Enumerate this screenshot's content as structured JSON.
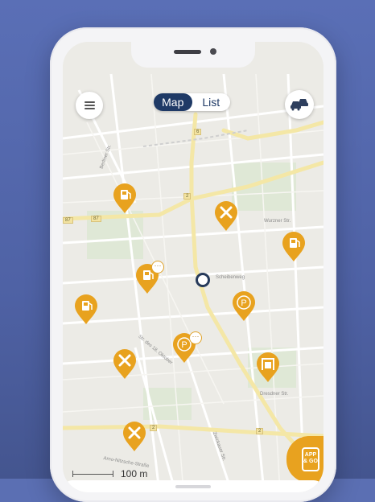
{
  "app": {
    "toggle": {
      "map_label": "Map",
      "list_label": "List",
      "active": "Map"
    }
  },
  "map": {
    "scale_label": "100 m",
    "street_labels": [
      "Scheibenweg",
      "Berliner Str.",
      "Wurzner Str.",
      "Str. des 18. Oktober",
      "Arno-Nitzsche-Straße",
      "Zwickauer Str.",
      "Dresdner Str."
    ],
    "route_shields": [
      "87",
      "87",
      "2",
      "2",
      "2",
      "6"
    ],
    "pins": [
      {
        "type": "fuel",
        "icon": "fuel-pump-icon"
      },
      {
        "type": "repair",
        "icon": "wrench-screwdriver-icon"
      },
      {
        "type": "fuel",
        "icon": "fuel-pump-icon"
      },
      {
        "type": "fuel",
        "icon": "fuel-pump-icon",
        "more": true
      },
      {
        "type": "parking",
        "icon": "parking-icon"
      },
      {
        "type": "fuel",
        "icon": "fuel-pump-icon"
      },
      {
        "type": "repair",
        "icon": "wrench-screwdriver-icon"
      },
      {
        "type": "parking",
        "icon": "parking-icon",
        "more": true
      },
      {
        "type": "car-wash",
        "icon": "car-wash-icon"
      },
      {
        "type": "repair",
        "icon": "wrench-screwdriver-icon"
      }
    ],
    "appgo_label": "APP & GO"
  },
  "colors": {
    "accent": "#e8a21f",
    "navy": "#1f3a66",
    "background": "#5b6fb3"
  }
}
